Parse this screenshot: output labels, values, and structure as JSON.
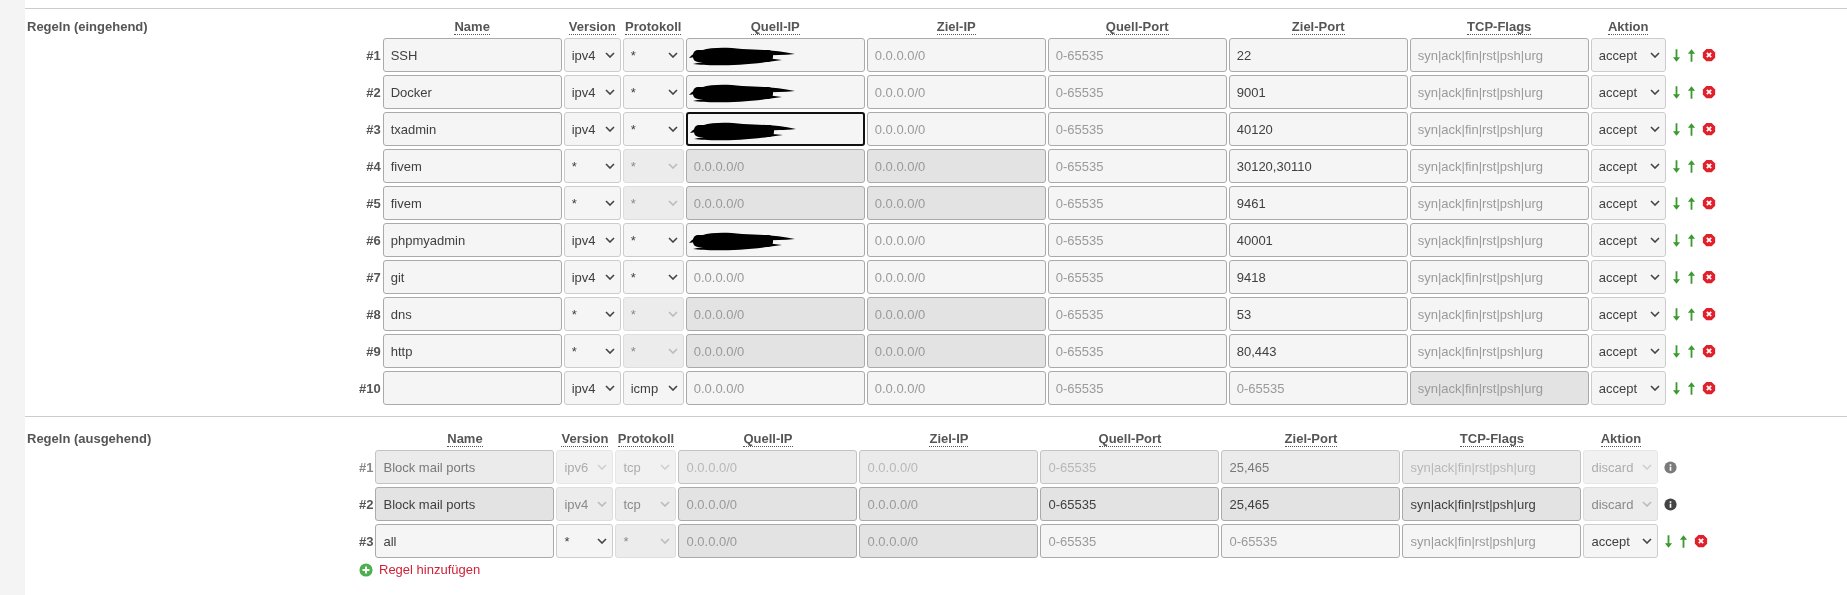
{
  "sections": [
    {
      "title": "Regeln (eingehend)",
      "columns": [
        "Name",
        "Version",
        "Protokoll",
        "Quell-IP",
        "Ziel-IP",
        "Quell-Port",
        "Ziel-Port",
        "TCP-Flags",
        "Aktion"
      ],
      "rules": [
        {
          "number": "#1",
          "kind": "editable",
          "inactive": false,
          "cells": [
            {
              "value": "SSH",
              "disabled": false
            },
            {
              "value": "ipv4",
              "disabled": false
            },
            {
              "value": "*",
              "disabled": false
            },
            {
              "redacted": true,
              "focused": false,
              "disabled": false
            },
            {
              "placeholder": "0.0.0.0/0",
              "disabled": false
            },
            {
              "placeholder": "0-65535",
              "disabled": false
            },
            {
              "value": "22",
              "disabled": false
            },
            {
              "placeholder": "syn|ack|fin|rst|psh|urg",
              "disabled": false
            },
            {
              "value": "accept",
              "disabled": false
            }
          ]
        },
        {
          "number": "#2",
          "kind": "editable",
          "inactive": false,
          "cells": [
            {
              "value": "Docker",
              "disabled": false
            },
            {
              "value": "ipv4",
              "disabled": false
            },
            {
              "value": "*",
              "disabled": false
            },
            {
              "redacted": true,
              "focused": false,
              "disabled": false
            },
            {
              "placeholder": "0.0.0.0/0",
              "disabled": false
            },
            {
              "placeholder": "0-65535",
              "disabled": false
            },
            {
              "value": "9001",
              "disabled": false
            },
            {
              "placeholder": "syn|ack|fin|rst|psh|urg",
              "disabled": false
            },
            {
              "value": "accept",
              "disabled": false
            }
          ]
        },
        {
          "number": "#3",
          "kind": "editable",
          "inactive": false,
          "cells": [
            {
              "value": "txadmin",
              "disabled": false
            },
            {
              "value": "ipv4",
              "disabled": false
            },
            {
              "value": "*",
              "disabled": false
            },
            {
              "redacted": true,
              "focused": true,
              "disabled": false
            },
            {
              "placeholder": "0.0.0.0/0",
              "disabled": false
            },
            {
              "placeholder": "0-65535",
              "disabled": false
            },
            {
              "value": "40120",
              "disabled": false
            },
            {
              "placeholder": "syn|ack|fin|rst|psh|urg",
              "disabled": false
            },
            {
              "value": "accept",
              "disabled": false
            }
          ]
        },
        {
          "number": "#4",
          "kind": "editable",
          "inactive": false,
          "cells": [
            {
              "value": "fivem",
              "disabled": false
            },
            {
              "value": "*",
              "disabled": false
            },
            {
              "value": "*",
              "disabled": true
            },
            {
              "placeholder": "0.0.0.0/0",
              "disabled": true
            },
            {
              "placeholder": "0.0.0.0/0",
              "disabled": true
            },
            {
              "placeholder": "0-65535",
              "disabled": false
            },
            {
              "value": "30120,30110",
              "disabled": false
            },
            {
              "placeholder": "syn|ack|fin|rst|psh|urg",
              "disabled": false
            },
            {
              "value": "accept",
              "disabled": false
            }
          ]
        },
        {
          "number": "#5",
          "kind": "editable",
          "inactive": false,
          "cells": [
            {
              "value": "fivem",
              "disabled": false
            },
            {
              "value": "*",
              "disabled": false
            },
            {
              "value": "*",
              "disabled": true
            },
            {
              "placeholder": "0.0.0.0/0",
              "disabled": true
            },
            {
              "placeholder": "0.0.0.0/0",
              "disabled": true
            },
            {
              "placeholder": "0-65535",
              "disabled": false
            },
            {
              "value": "9461",
              "disabled": false
            },
            {
              "placeholder": "syn|ack|fin|rst|psh|urg",
              "disabled": false
            },
            {
              "value": "accept",
              "disabled": false
            }
          ]
        },
        {
          "number": "#6",
          "kind": "editable",
          "inactive": false,
          "cells": [
            {
              "value": "phpmyadmin",
              "disabled": false
            },
            {
              "value": "ipv4",
              "disabled": false
            },
            {
              "value": "*",
              "disabled": false
            },
            {
              "redacted": true,
              "focused": false,
              "disabled": false
            },
            {
              "placeholder": "0.0.0.0/0",
              "disabled": false
            },
            {
              "placeholder": "0-65535",
              "disabled": false
            },
            {
              "value": "40001",
              "disabled": false
            },
            {
              "placeholder": "syn|ack|fin|rst|psh|urg",
              "disabled": false
            },
            {
              "value": "accept",
              "disabled": false
            }
          ]
        },
        {
          "number": "#7",
          "kind": "editable",
          "inactive": false,
          "cells": [
            {
              "value": "git",
              "disabled": false
            },
            {
              "value": "ipv4",
              "disabled": false
            },
            {
              "value": "*",
              "disabled": false
            },
            {
              "placeholder": "0.0.0.0/0",
              "disabled": false
            },
            {
              "placeholder": "0.0.0.0/0",
              "disabled": false
            },
            {
              "placeholder": "0-65535",
              "disabled": false
            },
            {
              "value": "9418",
              "disabled": false
            },
            {
              "placeholder": "syn|ack|fin|rst|psh|urg",
              "disabled": false
            },
            {
              "value": "accept",
              "disabled": false
            }
          ]
        },
        {
          "number": "#8",
          "kind": "editable",
          "inactive": false,
          "cells": [
            {
              "value": "dns",
              "disabled": false
            },
            {
              "value": "*",
              "disabled": false
            },
            {
              "value": "*",
              "disabled": true
            },
            {
              "placeholder": "0.0.0.0/0",
              "disabled": true
            },
            {
              "placeholder": "0.0.0.0/0",
              "disabled": true
            },
            {
              "placeholder": "0-65535",
              "disabled": false
            },
            {
              "value": "53",
              "disabled": false
            },
            {
              "placeholder": "syn|ack|fin|rst|psh|urg",
              "disabled": false
            },
            {
              "value": "accept",
              "disabled": false
            }
          ]
        },
        {
          "number": "#9",
          "kind": "editable",
          "inactive": false,
          "cells": [
            {
              "value": "http",
              "disabled": false
            },
            {
              "value": "*",
              "disabled": false
            },
            {
              "value": "*",
              "disabled": true
            },
            {
              "placeholder": "0.0.0.0/0",
              "disabled": true
            },
            {
              "placeholder": "0.0.0.0/0",
              "disabled": true
            },
            {
              "placeholder": "0-65535",
              "disabled": false
            },
            {
              "value": "80,443",
              "disabled": false
            },
            {
              "placeholder": "syn|ack|fin|rst|psh|urg",
              "disabled": false
            },
            {
              "value": "accept",
              "disabled": false
            }
          ]
        },
        {
          "number": "#10",
          "kind": "editable",
          "inactive": false,
          "cells": [
            {
              "disabled": false
            },
            {
              "value": "ipv4",
              "disabled": false
            },
            {
              "value": "icmp",
              "disabled": false
            },
            {
              "placeholder": "0.0.0.0/0",
              "disabled": false
            },
            {
              "placeholder": "0.0.0.0/0",
              "disabled": false
            },
            {
              "placeholder": "0-65535",
              "disabled": false
            },
            {
              "placeholder": "0-65535",
              "disabled": false
            },
            {
              "placeholder": "syn|ack|fin|rst|psh|urg",
              "disabled": true
            },
            {
              "value": "accept",
              "disabled": false
            }
          ]
        }
      ]
    },
    {
      "title": "Regeln (ausgehend)",
      "columns": [
        "Name",
        "Version",
        "Protokoll",
        "Quell-IP",
        "Ziel-IP",
        "Quell-Port",
        "Ziel-Port",
        "TCP-Flags",
        "Aktion"
      ],
      "rules": [
        {
          "number": "#1",
          "kind": "locked",
          "inactive": true,
          "cells": [
            {
              "value": "Block mail ports",
              "disabled": true
            },
            {
              "value": "ipv6",
              "disabled": true
            },
            {
              "value": "tcp",
              "disabled": true
            },
            {
              "placeholder": "0.0.0.0/0",
              "disabled": true
            },
            {
              "placeholder": "0.0.0.0/0",
              "disabled": true
            },
            {
              "placeholder": "0-65535",
              "disabled": true
            },
            {
              "value": "25,465",
              "disabled": true
            },
            {
              "placeholder": "syn|ack|fin|rst|psh|urg",
              "disabled": true
            },
            {
              "value": "discard",
              "disabled": true
            }
          ]
        },
        {
          "number": "#2",
          "kind": "locked",
          "inactive": false,
          "cells": [
            {
              "value": "Block mail ports",
              "disabled": true
            },
            {
              "value": "ipv4",
              "disabled": true
            },
            {
              "value": "tcp",
              "disabled": true
            },
            {
              "placeholder": "0.0.0.0/0",
              "disabled": true
            },
            {
              "placeholder": "0.0.0.0/0",
              "disabled": true
            },
            {
              "value": "0-65535",
              "disabled": true
            },
            {
              "value": "25,465",
              "disabled": true
            },
            {
              "value": "syn|ack|fin|rst|psh|urg",
              "disabled": true
            },
            {
              "value": "discard",
              "disabled": true
            }
          ]
        },
        {
          "number": "#3",
          "kind": "editable",
          "inactive": false,
          "cells": [
            {
              "value": "all",
              "disabled": false
            },
            {
              "value": "*",
              "disabled": false
            },
            {
              "value": "*",
              "disabled": true
            },
            {
              "placeholder": "0.0.0.0/0",
              "disabled": true
            },
            {
              "placeholder": "0.0.0.0/0",
              "disabled": true
            },
            {
              "placeholder": "0-65535",
              "disabled": false
            },
            {
              "placeholder": "0-65535",
              "disabled": false
            },
            {
              "placeholder": "syn|ack|fin|rst|psh|urg",
              "disabled": false
            },
            {
              "value": "accept",
              "disabled": false
            }
          ]
        }
      ],
      "add_link": "Regel hinzufügen"
    }
  ]
}
